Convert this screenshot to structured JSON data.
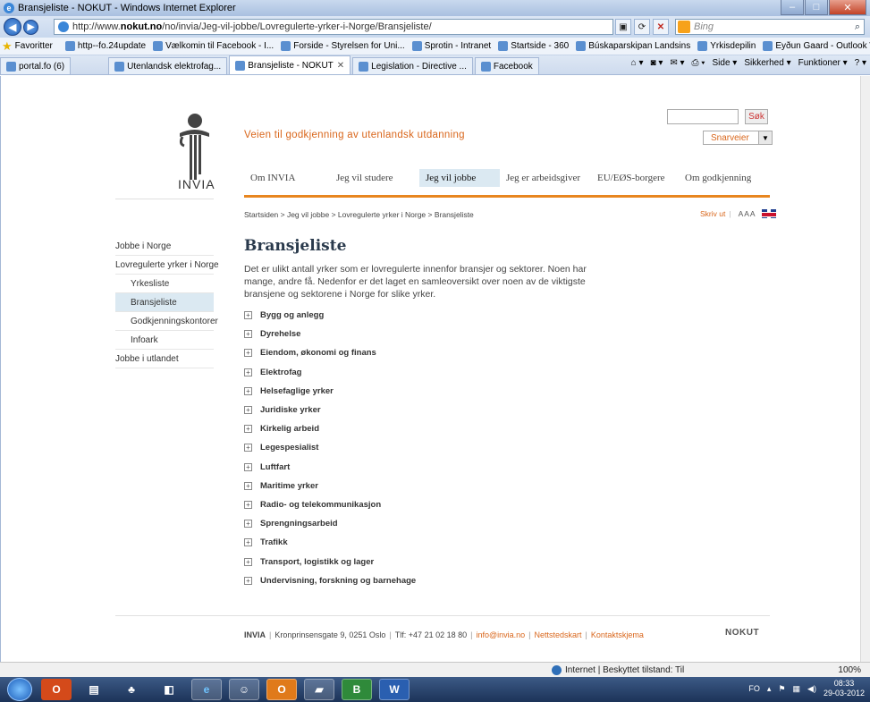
{
  "window": {
    "title": "Bransjeliste - NOKUT - Windows Internet Explorer"
  },
  "address": {
    "url_prefix": "http://www.",
    "url_domain": "nokut.no",
    "url_path": "/no/invia/Jeg-vil-jobbe/Lovregulerte-yrker-i-Norge/Bransjeliste/",
    "search_placeholder": "Bing"
  },
  "favorites": {
    "label": "Favoritter",
    "items": [
      "http--fo.24update",
      "Vælkomin til Facebook - I...",
      "Forside - Styrelsen for Uni...",
      "Sprotin - Intranet",
      "Startside - 360",
      "Búskaparskipan Landsins",
      "Yrkisdepilin",
      "Eyðun Gaard - Outlook W..."
    ]
  },
  "tabs": {
    "items": [
      {
        "label": "portal.fo (6)"
      },
      {
        "label": "Utenlandsk elektrofag..."
      },
      {
        "label": "Bransjeliste - NOKUT"
      },
      {
        "label": "Legislation - Directive ..."
      },
      {
        "label": "Facebook"
      }
    ],
    "tools": [
      "Side ▾",
      "Sikkerhed ▾",
      "Funktioner ▾"
    ]
  },
  "site": {
    "logo_text": "INVIA",
    "tagline": "Veien til godkjenning av utenlandsk utdanning",
    "search_button": "Søk",
    "shortcuts": "Snarveier",
    "nav": [
      "Om INVIA",
      "Jeg vil studere",
      "Jeg vil jobbe",
      "Jeg er arbeidsgiver",
      "EU/EØS-borgere",
      "Om godkjenning"
    ],
    "breadcrumb": "Startsiden > Jeg vil jobbe > Lovregulerte yrker i Norge > Bransjeliste",
    "print": "Skriv ut",
    "text_size": "AAA"
  },
  "sidebar": {
    "items": [
      "Jobbe i Norge",
      "Lovregulerte yrker i Norge",
      "Yrkesliste",
      "Bransjeliste",
      "Godkjenningskontorer",
      "Infoark",
      "Jobbe i utlandet"
    ]
  },
  "content": {
    "title": "Bransjeliste",
    "intro": "Det er ulikt antall yrker som er lovregulerte innenfor bransjer og sektorer. Noen har mange, andre få. Nedenfor er det laget en samleoversikt over noen av de viktigste bransjene og sektorene i Norge for slike yrker.",
    "branches": [
      "Bygg og anlegg",
      "Dyrehelse",
      "Eiendom, økonomi og finans",
      "Elektrofag",
      "Helsefaglige yrker",
      "Juridiske yrker",
      "Kirkelig arbeid",
      "Legespesialist",
      "Luftfart",
      "Maritime yrker",
      "Radio- og telekommunikasjon",
      "Sprengningsarbeid",
      "Trafikk",
      "Transport, logistikk og lager",
      "Undervisning, forskning og barnehage"
    ]
  },
  "footer": {
    "org": "INVIA",
    "address": "Kronprinsensgate 9, 0251 Oslo",
    "phone": "Tlf: +47 21 02 18 80",
    "email": "info@invia.no",
    "sitemap": "Nettstedskart",
    "contact": "Kontaktskjema",
    "nokut": "NOKUT"
  },
  "status": {
    "zone": "Internet | Beskyttet tilstand: Til",
    "zoom": "100%"
  },
  "tray": {
    "lang": "FO",
    "time": "08:33",
    "date": "29-03-2012"
  }
}
